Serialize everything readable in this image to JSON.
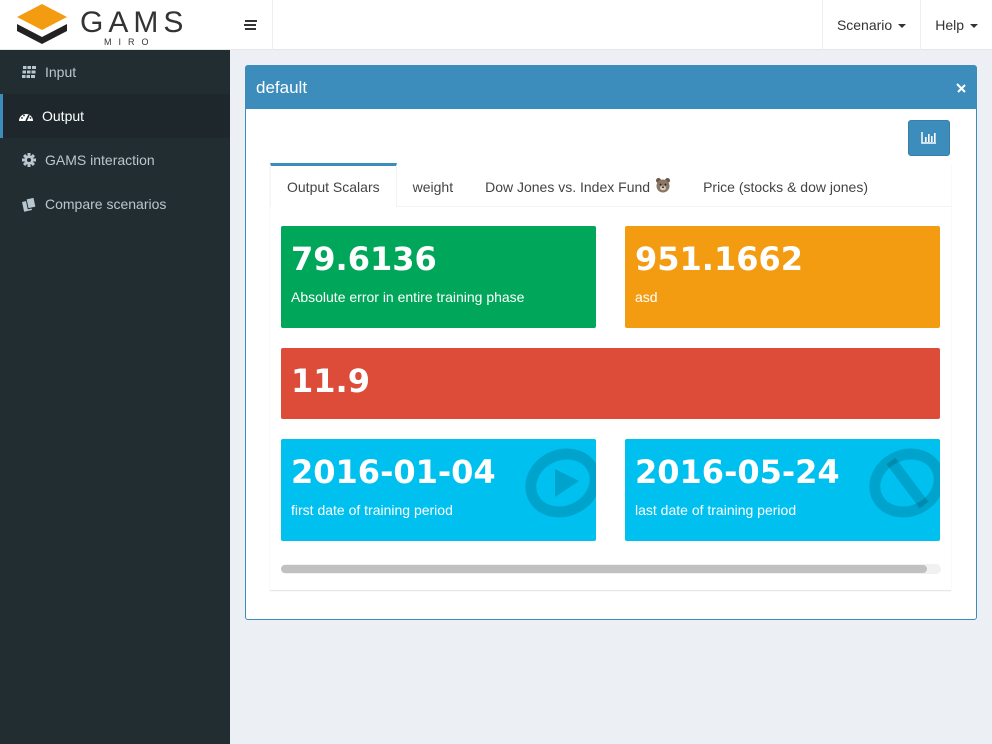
{
  "brand": {
    "name": "GAMS",
    "sub": "MIRO"
  },
  "topbar": {
    "menu_scenario": "Scenario",
    "menu_help": "Help"
  },
  "sidebar": {
    "items": [
      {
        "label": "Input",
        "icon": "table-icon",
        "active": false
      },
      {
        "label": "Output",
        "icon": "dashboard-icon",
        "active": true
      },
      {
        "label": "GAMS interaction",
        "icon": "gear-icon",
        "active": false
      },
      {
        "label": "Compare scenarios",
        "icon": "copy-icon",
        "active": false
      }
    ]
  },
  "panel": {
    "title": "default",
    "tabs": [
      {
        "label": "Output Scalars",
        "active": true
      },
      {
        "label": "weight",
        "active": false
      },
      {
        "label": "Dow Jones vs. Index Fund",
        "active": false,
        "icon": "bear-face-icon"
      },
      {
        "label": "Price (stocks & dow jones)",
        "active": false
      }
    ],
    "value_boxes": [
      {
        "value": "79.6136",
        "label": "Absolute error in entire training phase",
        "color": "#00a65a"
      },
      {
        "value": "951.1662",
        "label": "asd",
        "color": "#f39c12"
      },
      {
        "value": "11.9",
        "label": "",
        "color": "#dd4b39"
      },
      {
        "value": "2016-01-04",
        "label": "first date of training period",
        "color": "#00c0ef",
        "icon": "play-circle-icon"
      },
      {
        "value": "2016-05-24",
        "label": "last date of training period",
        "color": "#00c0ef",
        "icon": "ban-icon"
      }
    ]
  },
  "colors": {
    "primary": "#3c8dbc",
    "sidebar_bg": "#222d32",
    "content_bg": "#ecf0f5"
  }
}
